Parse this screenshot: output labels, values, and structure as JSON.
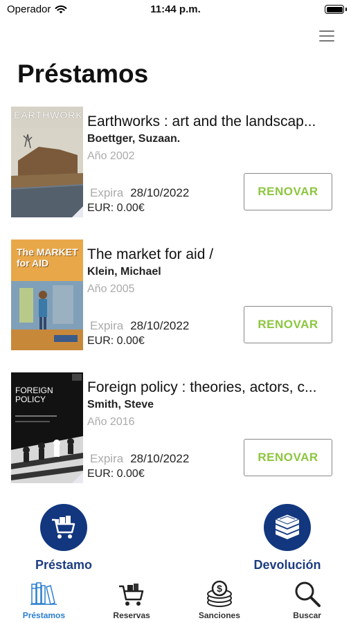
{
  "status_bar": {
    "carrier": "Operador",
    "time": "11:44 p.m."
  },
  "header": {
    "title": "Préstamos",
    "menu_icon": "hamburger-icon"
  },
  "loans": [
    {
      "title": "Earthworks : art and the landscap...",
      "author": "Boettger, Suzaan.",
      "year": "Año 2002",
      "expires_label": "Expira",
      "expires_date": "28/10/2022",
      "fee": "EUR: 0.00€",
      "renew_label": "RENOVAR",
      "cover_text": "EARTHWORKS"
    },
    {
      "title": "The market for aid /",
      "author": "Klein, Michael",
      "year": "Año 2005",
      "expires_label": "Expira",
      "expires_date": "28/10/2022",
      "fee": "EUR: 0.00€",
      "renew_label": "RENOVAR",
      "cover_text": "The MARKET for AID"
    },
    {
      "title": "Foreign policy : theories, actors, c...",
      "author": "Smith, Steve",
      "year": "Año 2016",
      "expires_label": "Expira",
      "expires_date": "28/10/2022",
      "fee": "EUR: 0.00€",
      "renew_label": "RENOVAR",
      "cover_text": "FOREIGN POLICY"
    }
  ],
  "actions": {
    "loan_label": "Préstamo",
    "return_label": "Devolución"
  },
  "tabs": [
    {
      "label": "Préstamos",
      "icon": "books-icon",
      "active": true
    },
    {
      "label": "Reservas",
      "icon": "cart-icon",
      "active": false
    },
    {
      "label": "Sanciones",
      "icon": "coins-icon",
      "active": false
    },
    {
      "label": "Buscar",
      "icon": "search-icon",
      "active": false
    }
  ],
  "colors": {
    "accent_green": "#8cc63f",
    "brand_blue": "#12377f",
    "tab_active": "#2a7fd0"
  }
}
